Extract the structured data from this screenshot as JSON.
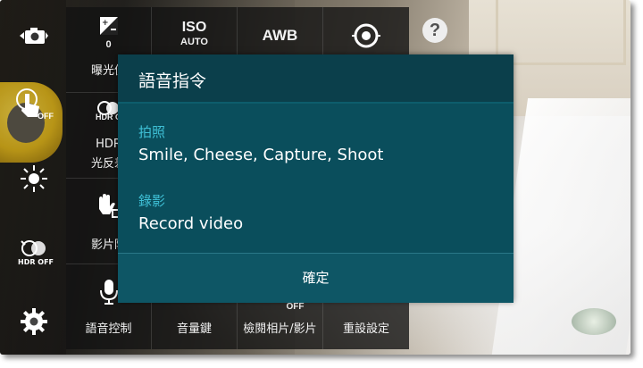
{
  "left_strip": {
    "icons": [
      "camera-switch-icon",
      "touch-shutter-off-icon",
      "flash-icon",
      "hdr-off-icon",
      "settings-gear-icon"
    ],
    "touch_off_badge": "OFF",
    "hdr_off_badge": "HDR OFF"
  },
  "settings_panel": {
    "exposure": {
      "value": "0",
      "label": "曝光值"
    },
    "iso": {
      "main": "ISO",
      "sub": "AUTO"
    },
    "awb": {
      "main": "AWB"
    },
    "hdr": {
      "badge": "HDR O",
      "label1": "HDR",
      "label2": "光反差"
    },
    "video_stabilization": {
      "label": "影片防"
    },
    "voice_control": {
      "label": "語音控制"
    },
    "volume_key": {
      "label": "音量鍵"
    },
    "review": {
      "badge": "OFF",
      "label": "檢閱相片/影片"
    },
    "reset": {
      "label": "重設設定"
    }
  },
  "help": {
    "symbol": "?"
  },
  "dialog": {
    "title": "語音指令",
    "photo_heading": "拍照",
    "photo_commands": "Smile, Cheese, Capture, Shoot",
    "video_heading": "錄影",
    "video_commands": "Record video",
    "ok_label": "確定"
  },
  "colors": {
    "dialog_bg": "#0a4e5c",
    "dialog_title_bg": "#0b3f4b",
    "accent_heading": "#3fc0d6",
    "panel_bg": "#121212"
  }
}
